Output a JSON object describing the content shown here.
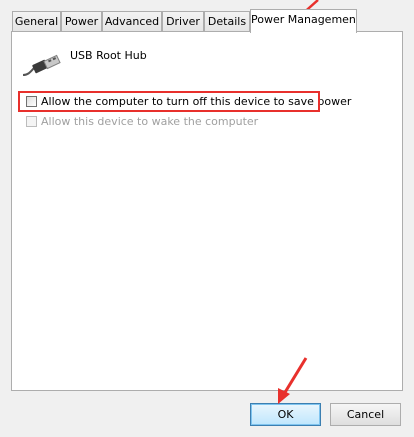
{
  "tabs": [
    {
      "label": "General",
      "active": false
    },
    {
      "label": "Power",
      "active": false
    },
    {
      "label": "Advanced",
      "active": false
    },
    {
      "label": "Driver",
      "active": false
    },
    {
      "label": "Details",
      "active": false
    },
    {
      "label": "Power Management",
      "active": true
    }
  ],
  "device": {
    "name": "USB Root Hub",
    "icon": "usb-plug-icon"
  },
  "options": [
    {
      "label": "Allow the computer to turn off this device to save power",
      "checked": false,
      "enabled": true,
      "highlighted": true
    },
    {
      "label": "Allow this device to wake the computer",
      "checked": false,
      "enabled": false,
      "highlighted": false
    }
  ],
  "buttons": {
    "ok_label": "OK",
    "cancel_label": "Cancel"
  },
  "colors": {
    "annotation_red": "#e8302c",
    "panel_bg": "#ffffff",
    "dialog_bg": "#f0f0f0"
  }
}
